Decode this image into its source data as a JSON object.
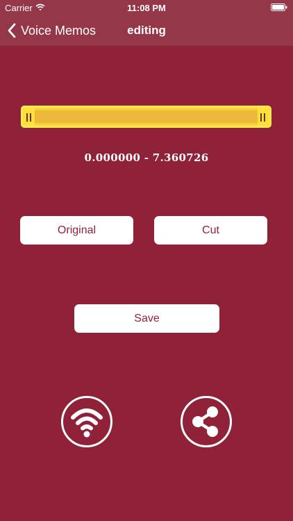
{
  "status_bar": {
    "carrier": "Carrier",
    "time": "11:08 PM"
  },
  "nav": {
    "back_label": "Voice Memos",
    "title": "editing"
  },
  "trim": {
    "range_text": "0.000000 - 7.360726",
    "start_fraction": 0.0,
    "end_fraction": 1.0
  },
  "buttons": {
    "original": "Original",
    "cut": "Cut",
    "save": "Save"
  },
  "icons": {
    "wifi_share": "wifi-icon",
    "share": "share-icon"
  },
  "colors": {
    "background": "#8f2238",
    "nav_bar": "#953748",
    "slider": "#f6cf3a",
    "button_text": "#8f2238"
  }
}
